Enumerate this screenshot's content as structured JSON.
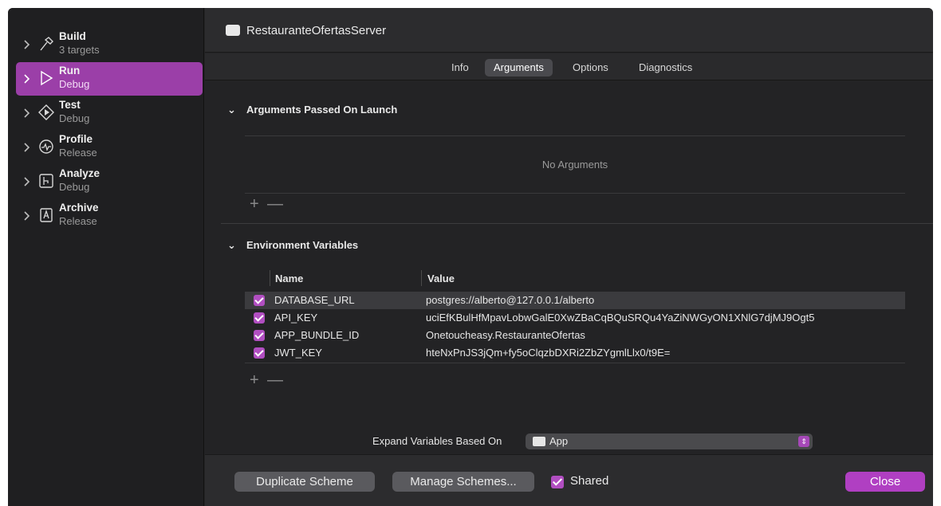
{
  "window": {
    "title": "RestauranteOfertasServer"
  },
  "sidebar": {
    "items": [
      {
        "title": "Build",
        "subtitle": "3 targets",
        "icon": "hammer-icon",
        "active": false
      },
      {
        "title": "Run",
        "subtitle": "Debug",
        "icon": "play-icon",
        "active": true
      },
      {
        "title": "Test",
        "subtitle": "Debug",
        "icon": "diamond-play-icon",
        "active": false
      },
      {
        "title": "Profile",
        "subtitle": "Release",
        "icon": "gauge-icon",
        "active": false
      },
      {
        "title": "Analyze",
        "subtitle": "Debug",
        "icon": "analyze-icon",
        "active": false
      },
      {
        "title": "Archive",
        "subtitle": "Release",
        "icon": "archive-icon",
        "active": false
      }
    ]
  },
  "tabs": [
    {
      "label": "Info",
      "selected": false
    },
    {
      "label": "Arguments",
      "selected": true
    },
    {
      "label": "Options",
      "selected": false
    },
    {
      "label": "Diagnostics",
      "selected": false
    }
  ],
  "arguments": {
    "heading": "Arguments Passed On Launch",
    "empty_text": "No Arguments",
    "add": "+",
    "remove": "—"
  },
  "environment": {
    "heading": "Environment Variables",
    "columns": {
      "name": "Name",
      "value": "Value"
    },
    "rows": [
      {
        "name": "DATABASE_URL",
        "value": "postgres://alberto@127.0.0.1/alberto",
        "checked": true
      },
      {
        "name": "API_KEY",
        "value": "uciEfKBulHfMpavLobwGalE0XwZBaCqBQuSRQu4YaZiNWGyON1XNlG7djMJ9Ogt5",
        "checked": true
      },
      {
        "name": "APP_BUNDLE_ID",
        "value": "Onetoucheasy.RestauranteOfertas",
        "checked": true
      },
      {
        "name": "JWT_KEY",
        "value": "hteNxPnJS3jQm+fy5oClqzbDXRi2ZbZYgmlLlx0/t9E=",
        "checked": true
      }
    ],
    "add": "+",
    "remove": "—"
  },
  "expand": {
    "label": "Expand Variables Based On",
    "value": "App"
  },
  "footer": {
    "duplicate": "Duplicate Scheme",
    "manage": "Manage Schemes...",
    "shared": "Shared",
    "close": "Close"
  },
  "colors": {
    "accent": "#b03fc2",
    "selection": "#9b3fa8",
    "background": "#242426"
  }
}
